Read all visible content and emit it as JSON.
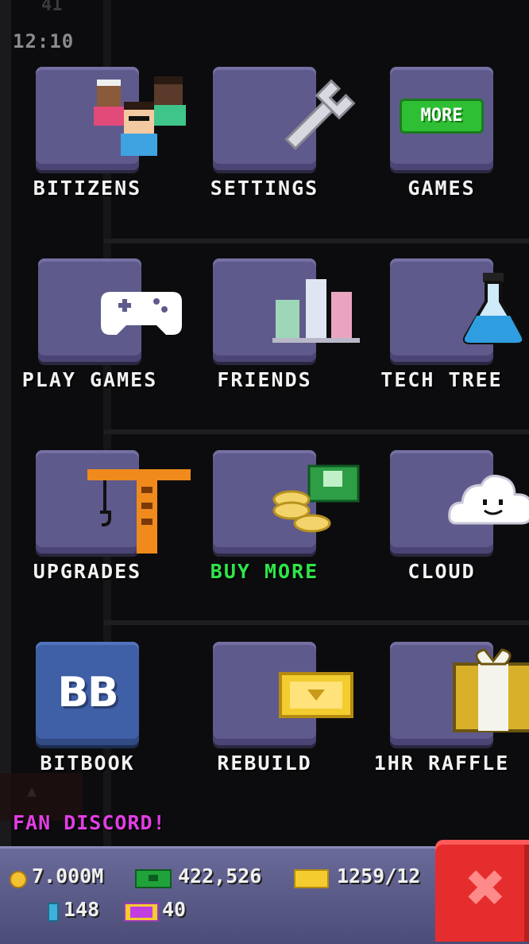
{
  "status": {
    "top_number": "41",
    "clock": "12:10"
  },
  "tiles": [
    {
      "label": "BITIZENS"
    },
    {
      "label": "SETTINGS"
    },
    {
      "label": "GAMES",
      "badge": "MORE"
    },
    {
      "label": "PLAY GAMES"
    },
    {
      "label": "FRIENDS"
    },
    {
      "label": "TECH TREE"
    },
    {
      "label": "UPGRADES"
    },
    {
      "label": "BUY MORE"
    },
    {
      "label": "CLOUD"
    },
    {
      "label": "BITBOOK",
      "badge": "BB"
    },
    {
      "label": "REBUILD"
    },
    {
      "label": "1HR RAFFLE"
    }
  ],
  "discord": {
    "label": "FAN DISCORD!"
  },
  "currency": {
    "coins": "7.000M",
    "bux": "422,526",
    "tickets": "1259/12",
    "gems": "148",
    "vip": "40"
  },
  "colors": {
    "tile": "#5f5a8c",
    "bitbook_tile": "#3f5fa6",
    "buy_more_label": "#2ee54a",
    "discord": "#e23ee3",
    "close": "#e62d2d"
  }
}
